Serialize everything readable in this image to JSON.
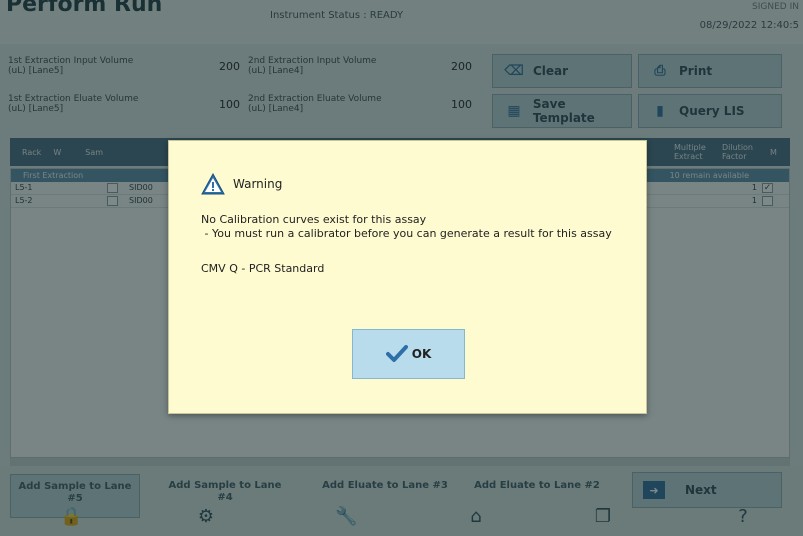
{
  "app": {
    "title": "Perform Run",
    "status": "Instrument Status : READY",
    "datetime": "08/29/2022 12:40:5",
    "corner": "SIGNED IN"
  },
  "params": [
    {
      "label": "1st Extraction Input Volume (uL) [Lane5]",
      "value": "200"
    },
    {
      "label": "2nd Extraction Input Volume (uL) [Lane4]",
      "value": "200"
    },
    {
      "label": "1st Extraction Eluate Volume (uL) [Lane5]",
      "value": "100"
    },
    {
      "label": "2nd Extraction Eluate Volume (uL) [Lane4]",
      "value": "100"
    }
  ],
  "toolbar": {
    "clear": "Clear",
    "print": "Print",
    "save_template": "Save Template",
    "query_lis": "Query LIS"
  },
  "table": {
    "headers": [
      "Rack",
      "W",
      "",
      "Sam",
      "Multiple Extract",
      "Dilution Factor",
      "M"
    ],
    "group": "First Extraction",
    "remain": "10 remain available",
    "rows": [
      {
        "pos": "L5-1",
        "sample": "SID00",
        "count": "1",
        "checked": "✓"
      },
      {
        "pos": "L5-2",
        "sample": "SID00",
        "count": "1",
        "checked": ""
      }
    ]
  },
  "bottom": {
    "add_sample_5": "Add Sample to Lane #5",
    "add_sample_4": "Add Sample to Lane #4",
    "add_eluate_3": "Add Eluate to Lane #3",
    "add_eluate_2": "Add Eluate to Lane #2",
    "next": "Next"
  },
  "dialog": {
    "title": "Warning",
    "message_line1": "No Calibration curves exist for this assay",
    "message_line2": " - You must run a calibrator before you can generate a result for this assay",
    "assay": "CMV Q - PCR Standard",
    "ok": "OK"
  },
  "colors": {
    "dialog_bg": "#fefbd1",
    "ok_button": "#b9dcec",
    "warning_icon": "#2d6fa8",
    "header_blue": "#476a83"
  }
}
